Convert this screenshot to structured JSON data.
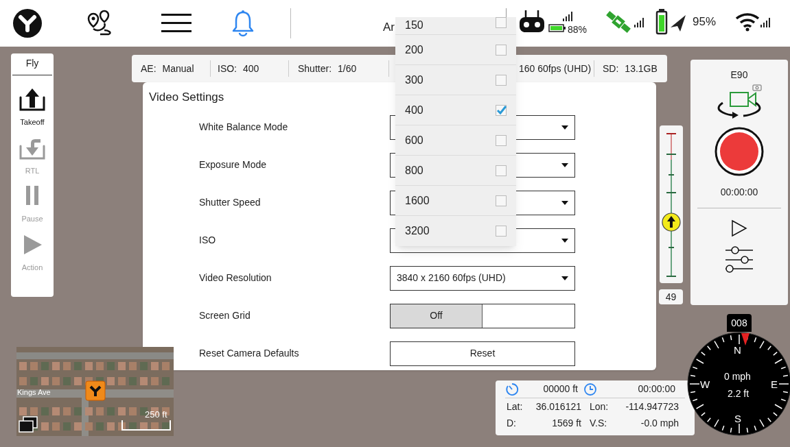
{
  "top_bar": {
    "partial_title": "Ar",
    "remote_battery": "88%",
    "aircraft_battery": "95%"
  },
  "info_bar": [
    {
      "label": "AE:",
      "value": "Manual"
    },
    {
      "label": "ISO:",
      "value": "400"
    },
    {
      "label": "Shutter:",
      "value": "1/60"
    },
    {
      "value": "160 60fps (UHD)"
    },
    {
      "label": "SD:",
      "value": "13.1GB"
    }
  ],
  "flight_panel": {
    "title": "Fly",
    "actions": [
      {
        "kind": "takeoff",
        "label": "Takeoff",
        "disabled": false
      },
      {
        "kind": "rtl",
        "label": "RTL",
        "disabled": true
      },
      {
        "kind": "pause",
        "label": "Pause",
        "disabled": true
      },
      {
        "kind": "action",
        "label": "Action",
        "disabled": true
      }
    ]
  },
  "video_settings": {
    "title": "Video Settings",
    "rows": [
      {
        "kind": "dropdown",
        "label": "White Balance Mode"
      },
      {
        "kind": "dropdown",
        "label": "Exposure Mode"
      },
      {
        "kind": "dropdown",
        "label": "Shutter Speed"
      },
      {
        "kind": "dropdown",
        "label": "ISO"
      },
      {
        "kind": "dropdown",
        "label": "Video Resolution",
        "value": "3840 x 2160 60fps (UHD)"
      },
      {
        "kind": "toggle",
        "label": "Screen Grid",
        "options": [
          {
            "label": "Off",
            "selected": true
          }
        ]
      },
      {
        "kind": "button",
        "label": "Reset Camera Defaults",
        "button": "Reset"
      }
    ]
  },
  "iso_dropdown": {
    "options": [
      {
        "label": "150",
        "checked": false
      },
      {
        "label": "200",
        "checked": false
      },
      {
        "label": "300",
        "checked": false
      },
      {
        "label": "400",
        "checked": true
      },
      {
        "label": "600",
        "checked": false
      },
      {
        "label": "800",
        "checked": false
      },
      {
        "label": "1600",
        "checked": false
      },
      {
        "label": "3200",
        "checked": false
      }
    ]
  },
  "altitude_slider": {
    "level": 0.38,
    "reading": "49"
  },
  "camera_panel": {
    "title": "E90",
    "record_time": "00:00:00"
  },
  "minimap": {
    "street_label": "Kings Ave",
    "scale": "250 ft"
  },
  "telemetry": {
    "altitude": "00000 ft",
    "flight_time": "00:00:00",
    "lat_label": "Lat:",
    "lat": "36.016121",
    "lon_label": "Lon:",
    "lon": "-114.947723",
    "distance_label": "D:",
    "distance": "1569 ft",
    "vs_label": "V.S:",
    "vs": "-0.0 mph"
  },
  "compass": {
    "heading": "008",
    "speed": "0 mph",
    "height": "2.2 ft",
    "north": "N",
    "east": "E",
    "south": "S",
    "west": "W"
  }
}
